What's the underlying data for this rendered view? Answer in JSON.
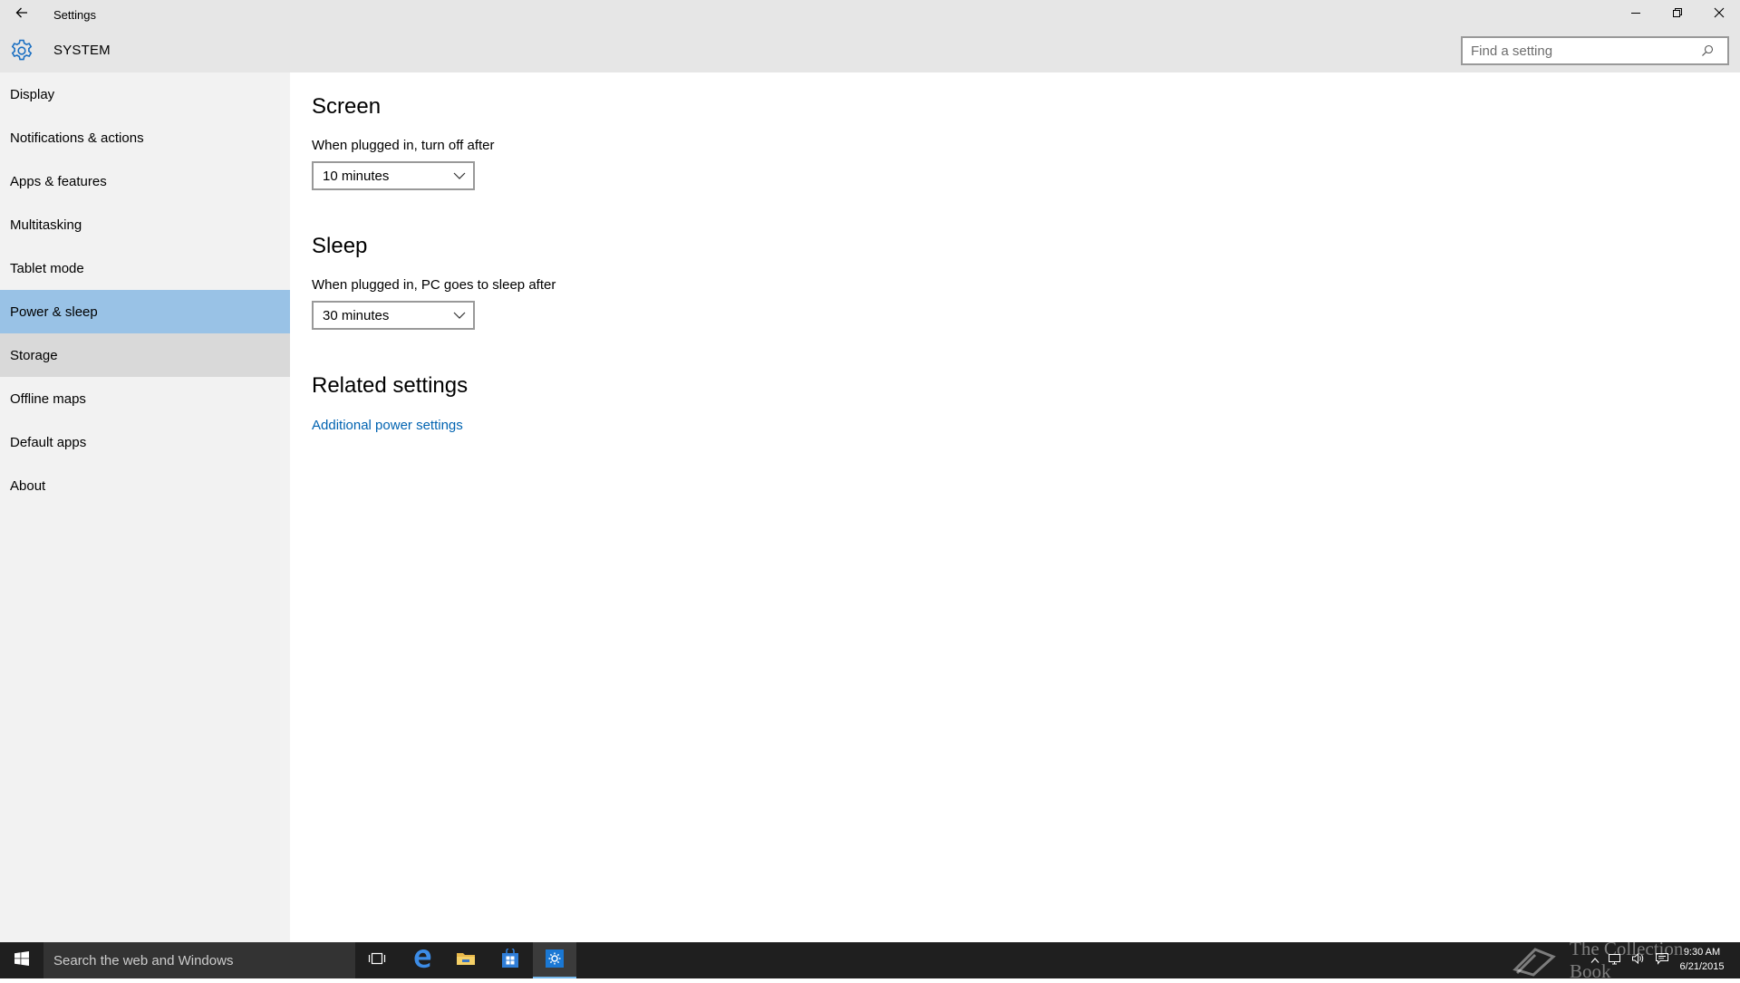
{
  "window": {
    "title": "Settings",
    "controls": [
      "minimize",
      "restore",
      "close"
    ]
  },
  "header": {
    "icon": "gear-icon",
    "title": "SYSTEM",
    "search_placeholder": "Find a setting"
  },
  "sidebar": {
    "items": [
      {
        "label": "Display",
        "state": "normal"
      },
      {
        "label": "Notifications & actions",
        "state": "normal"
      },
      {
        "label": "Apps & features",
        "state": "normal"
      },
      {
        "label": "Multitasking",
        "state": "normal"
      },
      {
        "label": "Tablet mode",
        "state": "normal"
      },
      {
        "label": "Power & sleep",
        "state": "selected"
      },
      {
        "label": "Storage",
        "state": "hover"
      },
      {
        "label": "Offline maps",
        "state": "normal"
      },
      {
        "label": "Default apps",
        "state": "normal"
      },
      {
        "label": "About",
        "state": "normal"
      }
    ]
  },
  "main": {
    "screen": {
      "title": "Screen",
      "label": "When plugged in, turn off after",
      "value": "10 minutes"
    },
    "sleep": {
      "title": "Sleep",
      "label": "When plugged in, PC goes to sleep after",
      "value": "30 minutes"
    },
    "related": {
      "title": "Related settings",
      "link": "Additional power settings"
    }
  },
  "taskbar": {
    "search_placeholder": "Search the web and Windows",
    "apps": [
      "task-view-icon",
      "edge-icon",
      "file-explorer-icon",
      "store-icon",
      "settings-icon"
    ],
    "active_app": "settings-icon",
    "clock_time": "9:30 AM",
    "clock_date": "6/21/2015",
    "watermark": "The Collection Book"
  },
  "colors": {
    "titlebar": "#e6e6e6",
    "sidebar": "#f2f2f2",
    "selected": "#99c2e6",
    "hover": "#d9d9d9",
    "accent": "#0063b1",
    "taskbar": "#1f1f1f"
  }
}
